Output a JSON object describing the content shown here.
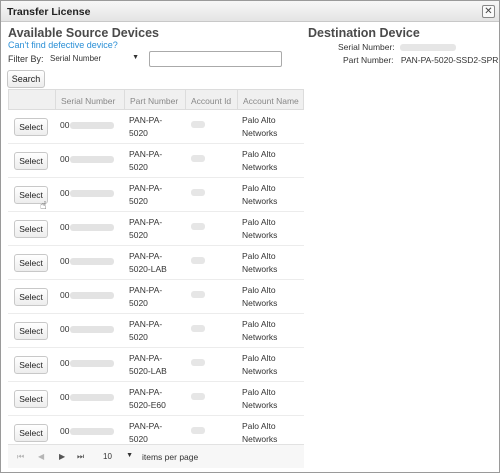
{
  "window": {
    "title": "Transfer License",
    "close_glyph": "✕"
  },
  "source": {
    "heading": "Available Source Devices",
    "defective_link": "Can't find defective device?",
    "filter_label": "Filter By:",
    "filter_select_value": "Serial Number",
    "filter_input_value": "",
    "search_button": "Search"
  },
  "destination": {
    "heading": "Destination Device",
    "serial_label": "Serial Number:",
    "part_label": "Part Number:",
    "part_value": "PAN-PA-5020-SSD2-SPR"
  },
  "table": {
    "columns": [
      "Serial Number",
      "Part Number",
      "Account Id",
      "Account Name"
    ],
    "select_label": "Select",
    "rows": [
      {
        "serial_prefix": "00",
        "part": "PAN-PA-5020",
        "account_name": "Palo Alto Networks"
      },
      {
        "serial_prefix": "00",
        "part": "PAN-PA-5020",
        "account_name": "Palo Alto Networks"
      },
      {
        "serial_prefix": "00",
        "part": "PAN-PA-5020",
        "account_name": "Palo Alto Networks"
      },
      {
        "serial_prefix": "00",
        "part": "PAN-PA-5020",
        "account_name": "Palo Alto Networks"
      },
      {
        "serial_prefix": "00",
        "part": "PAN-PA-5020-LAB",
        "account_name": "Palo Alto Networks"
      },
      {
        "serial_prefix": "00",
        "part": "PAN-PA-5020",
        "account_name": "Palo Alto Networks"
      },
      {
        "serial_prefix": "00",
        "part": "PAN-PA-5020",
        "account_name": "Palo Alto Networks"
      },
      {
        "serial_prefix": "00",
        "part": "PAN-PA-5020-LAB",
        "account_name": "Palo Alto Networks"
      },
      {
        "serial_prefix": "00",
        "part": "PAN-PA-5020-E60",
        "account_name": "Palo Alto Networks"
      },
      {
        "serial_prefix": "00",
        "part": "PAN-PA-5020",
        "account_name": "Palo Alto Networks"
      }
    ]
  },
  "pager": {
    "first_glyph": "⏮",
    "prev_glyph": "◀",
    "next_glyph": "▶",
    "last_glyph": "⏭",
    "page_size": "10",
    "per_page_label": "items per page"
  }
}
